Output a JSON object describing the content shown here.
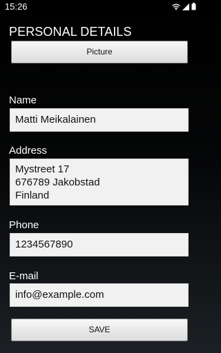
{
  "status_bar": {
    "time": "15:26",
    "icons": [
      "wifi-icon",
      "signal-icon",
      "battery-icon"
    ]
  },
  "page": {
    "title": "PERSONAL DETAILS"
  },
  "picture_button": {
    "label": "Picture"
  },
  "form": {
    "name": {
      "label": "Name",
      "value": "Matti Meikalainen"
    },
    "address": {
      "label": "Address",
      "value": "Mystreet 17\n676789 Jakobstad\nFinland"
    },
    "phone": {
      "label": "Phone",
      "value": "1234567890"
    },
    "email": {
      "label": "E-mail",
      "value": "info@example.com"
    }
  },
  "save_button": {
    "label": "SAVE"
  },
  "colors": {
    "background_top": "#000000",
    "background_bottom": "#1c2024",
    "field_background": "#f1f1f1",
    "button_background": "#e8e8e8",
    "text_light": "#ffffff",
    "text_dark": "#111111"
  }
}
